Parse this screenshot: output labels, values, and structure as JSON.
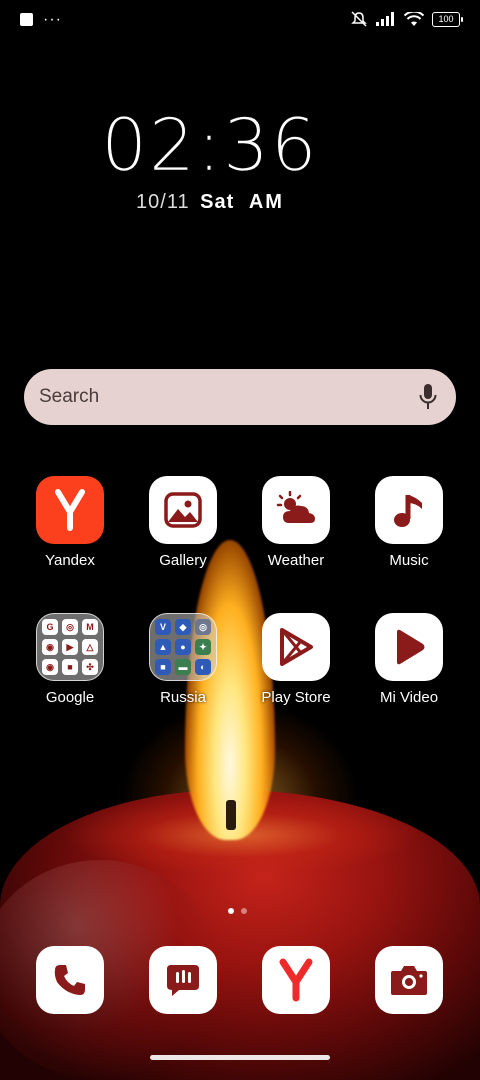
{
  "status_bar": {
    "left_icons": [
      "screenshot-icon",
      "more-dots-icon"
    ],
    "more_text": "···",
    "right_icons": [
      "silent-icon",
      "signal-icon",
      "wifi-icon",
      "battery-icon"
    ],
    "battery": "100"
  },
  "clock": {
    "time": "02:36",
    "date": "10/11",
    "weekday": "Sat",
    "ampm": "AM"
  },
  "search": {
    "placeholder": "Search"
  },
  "apps_row1": [
    {
      "label": "Yandex",
      "icon": "yandex-icon"
    },
    {
      "label": "Gallery",
      "icon": "gallery-icon"
    },
    {
      "label": "Weather",
      "icon": "weather-icon"
    },
    {
      "label": "Music",
      "icon": "music-icon"
    }
  ],
  "apps_row2": [
    {
      "label": "Google",
      "icon": "folder-icon"
    },
    {
      "label": "Russia",
      "icon": "folder-icon"
    },
    {
      "label": "Play Store",
      "icon": "play-store-icon"
    },
    {
      "label": "Mi Video",
      "icon": "mi-video-icon"
    }
  ],
  "dock": [
    {
      "icon": "phone-icon"
    },
    {
      "icon": "messages-icon"
    },
    {
      "icon": "yandex-browser-icon"
    },
    {
      "icon": "camera-icon"
    }
  ],
  "colors": {
    "accent": "#8b1a1a",
    "yandex_red": "#fc3f1d",
    "search_bg": "#e6d2d1"
  }
}
